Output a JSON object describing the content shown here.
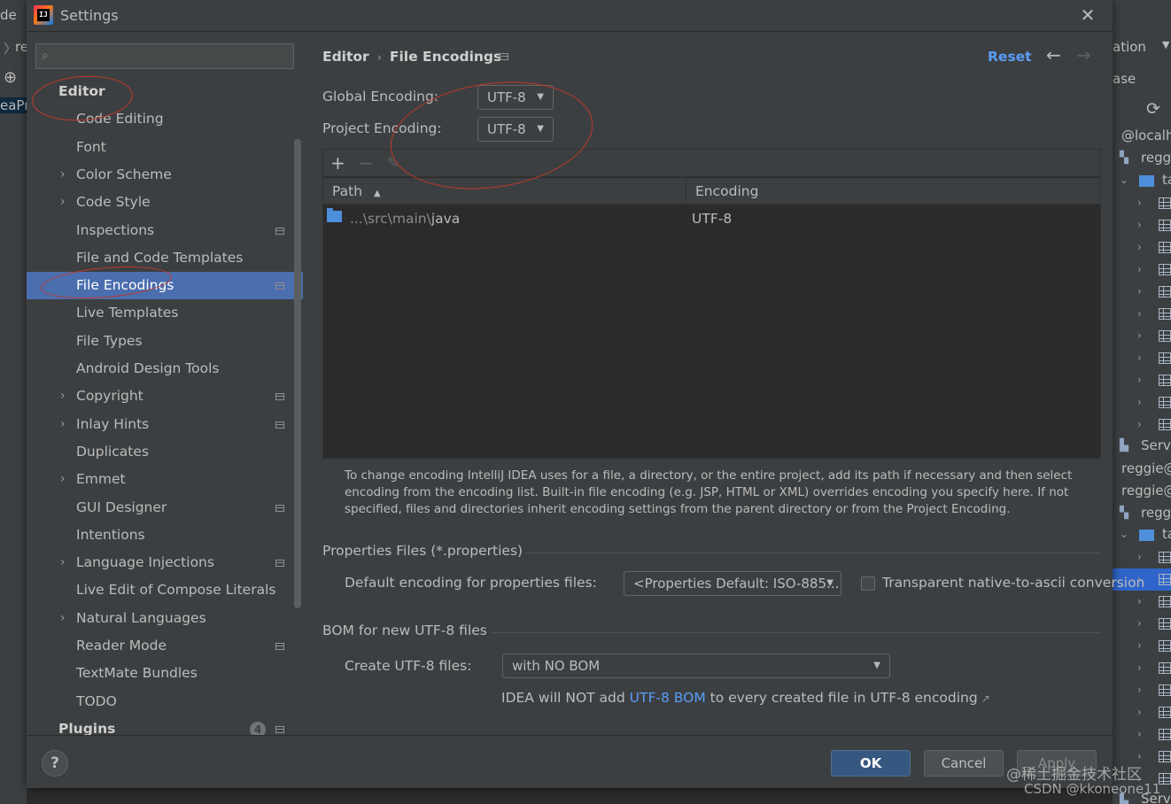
{
  "background_ide": {
    "left_fragments": [
      "de",
      "re",
      "eaPr"
    ],
    "right_texts": [
      "ation",
      "ase",
      "@localh",
      "regg",
      "ta",
      "Serv",
      "reggie@",
      "reggie@",
      "regg",
      "ta",
      "Serv"
    ]
  },
  "dialog": {
    "title": "Settings",
    "logo_text": "IJ"
  },
  "sidebar": {
    "search": {
      "value": "",
      "placeholder": ""
    },
    "items": [
      {
        "label": "Editor",
        "section": true
      },
      {
        "label": "Code Editing"
      },
      {
        "label": "Font"
      },
      {
        "label": "Color Scheme",
        "expandable": true
      },
      {
        "label": "Code Style",
        "expandable": true
      },
      {
        "label": "Inspections",
        "project": true
      },
      {
        "label": "File and Code Templates"
      },
      {
        "label": "File Encodings",
        "project": true,
        "selected": true
      },
      {
        "label": "Live Templates"
      },
      {
        "label": "File Types"
      },
      {
        "label": "Android Design Tools"
      },
      {
        "label": "Copyright",
        "expandable": true,
        "project": true
      },
      {
        "label": "Inlay Hints",
        "expandable": true,
        "project": true
      },
      {
        "label": "Duplicates"
      },
      {
        "label": "Emmet",
        "expandable": true
      },
      {
        "label": "GUI Designer",
        "project": true
      },
      {
        "label": "Intentions"
      },
      {
        "label": "Language Injections",
        "expandable": true,
        "project": true
      },
      {
        "label": "Live Edit of Compose Literals"
      },
      {
        "label": "Natural Languages",
        "expandable": true
      },
      {
        "label": "Reader Mode",
        "project": true
      },
      {
        "label": "TextMate Bundles"
      },
      {
        "label": "TODO"
      },
      {
        "label": "Plugins",
        "section": true,
        "badge": "4",
        "project": true
      }
    ]
  },
  "content": {
    "breadcrumb": {
      "parent": "Editor",
      "separator": "›",
      "current": "File Encodings"
    },
    "reset_label": "Reset",
    "back_icon": "←",
    "forward_icon": "→",
    "global_encoding": {
      "label": "Global Encoding:",
      "value": "UTF-8"
    },
    "project_encoding": {
      "label": "Project Encoding:",
      "value": "UTF-8"
    },
    "table": {
      "toolbar": {
        "add_icon": "+",
        "remove_icon": "−",
        "edit_icon": "✎"
      },
      "columns": {
        "path": "Path",
        "encoding": "Encoding"
      },
      "sort_indicator": "▲",
      "rows": [
        {
          "path_prefix": "...\\src\\main\\",
          "path_name": "java",
          "encoding": "UTF-8"
        }
      ]
    },
    "help_text": "To change encoding IntelliJ IDEA uses for a file, a directory, or the entire project, add its path if necessary and then select encoding from the encoding list. Built-in file encoding (e.g. JSP, HTML or XML) overrides encoding you specify here. If not specified, files and directories inherit encoding settings from the parent directory or from the Project Encoding.",
    "properties": {
      "section_title": "Properties Files (*.properties)",
      "default_label": "Default encoding for properties files:",
      "default_value": "<Properties Default: ISO-885...",
      "transparent_label": "Transparent native-to-ascii conversion",
      "transparent_checked": false
    },
    "bom": {
      "section_title": "BOM for new UTF-8 files",
      "create_label": "Create UTF-8 files:",
      "create_value": "with NO BOM",
      "note_prefix": "IDEA will NOT add ",
      "note_link": "UTF-8 BOM",
      "note_suffix": " to every created file in UTF-8 encoding",
      "note_ext_icon": "↗"
    }
  },
  "footer": {
    "help_label": "?",
    "ok_label": "OK",
    "cancel_label": "Cancel",
    "apply_label": "Apply"
  },
  "watermark": {
    "line1": "@稀土掘金技术社区",
    "line2": "CSDN @kkoneone11"
  },
  "colors": {
    "selection": "#4b6eaf",
    "link": "#589df6",
    "annotation": "#c0392b",
    "ok_button": "#365880"
  }
}
